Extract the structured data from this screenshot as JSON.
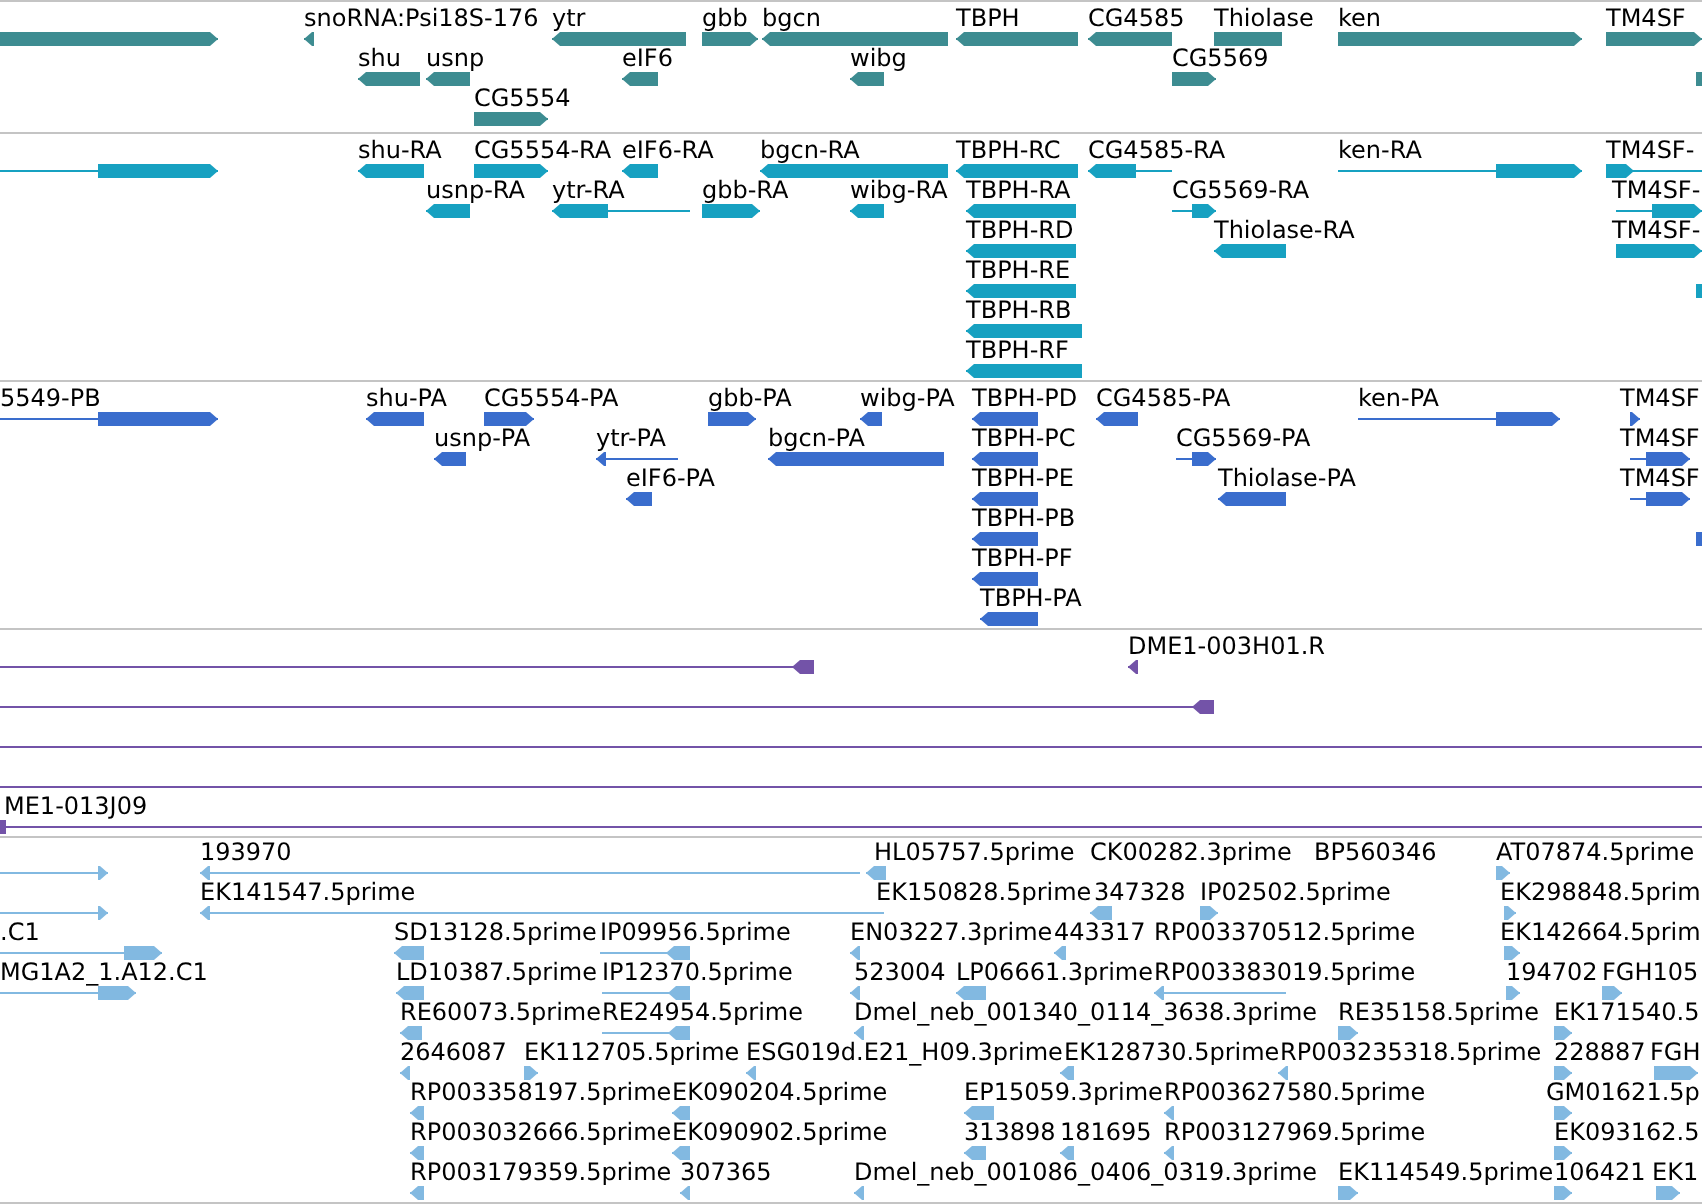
{
  "tracks": [
    {
      "kind": "genes",
      "rows": [
        {
          "features": [
            {
              "kind": "forward"
            },
            {
              "label": "snoRNA:Psi18S-176",
              "kind": "reverse"
            },
            {
              "label": "ytr",
              "kind": "reverse"
            },
            {
              "label": "gbb",
              "kind": "forward"
            },
            {
              "label": "bgcn",
              "kind": "reverse"
            },
            {
              "label": "TBPH",
              "kind": "reverse"
            },
            {
              "label": "CG4585",
              "kind": "reverse"
            },
            {
              "label": "Thiolase",
              "kind": "plain"
            },
            {
              "label": "ken",
              "kind": "forward"
            },
            {
              "label": "TM4SF",
              "kind": "forward"
            }
          ]
        },
        {
          "features": [
            {
              "label": "shu",
              "kind": "reverse"
            },
            {
              "label": "usnp",
              "kind": "reverse"
            },
            {
              "label": "eIF6",
              "kind": "reverse"
            },
            {
              "label": "wibg",
              "kind": "reverse"
            },
            {
              "label": "CG5569",
              "kind": "forward"
            },
            {
              "kind": "plain"
            }
          ]
        },
        {
          "features": [
            {
              "label": "CG5554",
              "kind": "forward"
            }
          ]
        }
      ]
    },
    {
      "kind": "transcripts",
      "rows": [
        {
          "features": [
            {
              "kind": "forward"
            },
            {
              "label": "shu-RA",
              "kind": "reverse"
            },
            {
              "label": "CG5554-RA",
              "kind": "forward"
            },
            {
              "label": "eIF6-RA",
              "kind": "reverse"
            },
            {
              "label": "bgcn-RA",
              "kind": "reverse"
            },
            {
              "label": "TBPH-RC",
              "kind": "reverse"
            },
            {
              "label": "CG4585-RA",
              "kind": "reverse"
            },
            {
              "label": "ken-RA",
              "kind": "forward"
            },
            {
              "label": "TM4SF-",
              "kind": "forward"
            }
          ]
        },
        {
          "features": [
            {
              "label": "usnp-RA",
              "kind": "reverse"
            },
            {
              "label": "ytr-RA",
              "kind": "reverse"
            },
            {
              "label": "gbb-RA",
              "kind": "forward"
            },
            {
              "label": "wibg-RA",
              "kind": "reverse"
            },
            {
              "label": "TBPH-RA",
              "kind": "reverse"
            },
            {
              "label": "CG5569-RA",
              "kind": "forward"
            },
            {
              "label": "TM4SF-",
              "kind": "forward"
            }
          ]
        },
        {
          "features": [
            {
              "label": "TBPH-RD",
              "kind": "reverse"
            },
            {
              "label": "Thiolase-RA",
              "kind": "reverse"
            },
            {
              "label": "TM4SF-",
              "kind": "forward"
            }
          ]
        },
        {
          "features": [
            {
              "label": "TBPH-RE",
              "kind": "reverse"
            },
            {
              "kind": "plain"
            }
          ]
        },
        {
          "features": [
            {
              "label": "TBPH-RB",
              "kind": "reverse"
            }
          ]
        },
        {
          "features": [
            {
              "label": "TBPH-RF",
              "kind": "reverse"
            }
          ]
        }
      ]
    },
    {
      "kind": "proteins",
      "rows": [
        {
          "features": [
            {
              "label": "5549-PB",
              "kind": "forward"
            },
            {
              "label": "shu-PA",
              "kind": "reverse"
            },
            {
              "label": "CG5554-PA",
              "kind": "forward"
            },
            {
              "label": "gbb-PA",
              "kind": "forward"
            },
            {
              "label": "wibg-PA",
              "kind": "reverse"
            },
            {
              "label": "TBPH-PD",
              "kind": "reverse"
            },
            {
              "label": "CG4585-PA",
              "kind": "reverse"
            },
            {
              "label": "ken-PA",
              "kind": "forward"
            },
            {
              "label": "TM4SF",
              "kind": "forward"
            }
          ]
        },
        {
          "features": [
            {
              "label": "usnp-PA",
              "kind": "reverse"
            },
            {
              "label": "ytr-PA",
              "kind": "reverse"
            },
            {
              "label": "bgcn-PA",
              "kind": "reverse"
            },
            {
              "label": "TBPH-PC",
              "kind": "reverse"
            },
            {
              "label": "CG5569-PA",
              "kind": "forward"
            },
            {
              "label": "TM4SF",
              "kind": "forward"
            }
          ]
        },
        {
          "features": [
            {
              "label": "eIF6-PA",
              "kind": "reverse"
            },
            {
              "label": "TBPH-PE",
              "kind": "reverse"
            },
            {
              "label": "Thiolase-PA",
              "kind": "reverse"
            },
            {
              "label": "TM4SF",
              "kind": "forward"
            }
          ]
        },
        {
          "features": [
            {
              "label": "TBPH-PB",
              "kind": "reverse"
            },
            {
              "kind": "plain"
            }
          ]
        },
        {
          "features": [
            {
              "label": "TBPH-PF",
              "kind": "reverse"
            }
          ]
        },
        {
          "features": [
            {
              "label": "TBPH-PA",
              "kind": "reverse"
            }
          ]
        }
      ]
    },
    {
      "kind": "clones",
      "rows": [
        {
          "features": [
            {
              "kind": "reverse"
            },
            {
              "label": "DME1-003H01.R",
              "kind": "reverse"
            }
          ]
        },
        {
          "features": [
            {
              "kind": "reverse"
            }
          ]
        },
        {
          "features": [
            {
              "kind": "plain"
            }
          ]
        },
        {
          "features": [
            {
              "kind": "plain"
            }
          ]
        },
        {
          "features": [
            {
              "label": "ME1-013J09",
              "kind": "plain"
            }
          ]
        }
      ]
    },
    {
      "kind": "ests",
      "rows": [
        {
          "features": [
            {
              "kind": "forward"
            },
            {
              "label": "193970",
              "kind": "reverse"
            },
            {
              "label": "HL05757.5prime",
              "kind": "reverse"
            },
            {
              "label": "CK00282.3prime",
              "kind": "text"
            },
            {
              "label": "BP560346",
              "kind": "text"
            },
            {
              "label": "AT07874.5prime",
              "kind": "forward"
            }
          ]
        },
        {
          "features": [
            {
              "kind": "forward"
            },
            {
              "label": "EK141547.5prime",
              "kind": "reverse"
            },
            {
              "label": "EK150828.5prime",
              "kind": "text"
            },
            {
              "label": "347328",
              "kind": "reverse"
            },
            {
              "label": "IP02502.5prime",
              "kind": "forward"
            },
            {
              "label": "EK298848.5prim",
              "kind": "forward"
            }
          ]
        },
        {
          "features": [
            {
              "label": ".C1",
              "kind": "forward"
            },
            {
              "label": "SD13128.5prime",
              "kind": "reverse"
            },
            {
              "label": "IP09956.5prime",
              "kind": "reverse"
            },
            {
              "label": "EN03227.3prime",
              "kind": "reverse"
            },
            {
              "label": "443317",
              "kind": "reverse"
            },
            {
              "label": "RP003370512.5prime",
              "kind": "text"
            },
            {
              "label": "EK142664.5prim",
              "kind": "forward"
            }
          ]
        },
        {
          "features": [
            {
              "label": "MG1A2_1.A12.C1",
              "kind": "forward"
            },
            {
              "label": "LD10387.5prime",
              "kind": "reverse"
            },
            {
              "label": "IP12370.5prime",
              "kind": "reverse"
            },
            {
              "label": "523004",
              "kind": "reverse"
            },
            {
              "label": "LP06661.3prime",
              "kind": "reverse"
            },
            {
              "label": "RP003383019.5prime",
              "kind": "reverse"
            },
            {
              "label": "194702",
              "kind": "forward"
            },
            {
              "label": "FGH105",
              "kind": "forward"
            }
          ]
        },
        {
          "features": [
            {
              "label": "RE60073.5prime",
              "kind": "reverse"
            },
            {
              "label": "RE24954.5prime",
              "kind": "reverse"
            },
            {
              "label": "Dmel_neb_001340_0114_3638.3prime",
              "kind": "reverse"
            },
            {
              "label": "RE35158.5prime",
              "kind": "forward"
            },
            {
              "label": "EK171540.5",
              "kind": "forward"
            }
          ]
        },
        {
          "features": [
            {
              "label": "2646087",
              "kind": "reverse"
            },
            {
              "label": "EK112705.5prime",
              "kind": "forward"
            },
            {
              "label": "ESG019d.E21_H09.3prime",
              "kind": "reverse"
            },
            {
              "label": "EK128730.5prime",
              "kind": "reverse"
            },
            {
              "label": "RP003235318.5prime",
              "kind": "reverse"
            },
            {
              "label": "228887",
              "kind": "forward"
            },
            {
              "label": "FGH",
              "kind": "forward"
            }
          ]
        },
        {
          "features": [
            {
              "label": "RP003358197.5prime",
              "kind": "reverse"
            },
            {
              "label": "EK090204.5prime",
              "kind": "reverse"
            },
            {
              "label": "EP15059.3prime",
              "kind": "reverse"
            },
            {
              "label": "RP003627580.5prime",
              "kind": "reverse"
            },
            {
              "label": "GM01621.5p",
              "kind": "forward"
            }
          ]
        },
        {
          "features": [
            {
              "label": "RP003032666.5prime",
              "kind": "reverse"
            },
            {
              "label": "EK090902.5prime",
              "kind": "reverse"
            },
            {
              "label": "313898",
              "kind": "reverse"
            },
            {
              "label": "181695",
              "kind": "reverse"
            },
            {
              "label": "RP003127969.5prime",
              "kind": "reverse"
            },
            {
              "label": "EK093162.5",
              "kind": "forward"
            }
          ]
        },
        {
          "features": [
            {
              "label": "RP003179359.5prime",
              "kind": "reverse"
            },
            {
              "label": "307365",
              "kind": "reverse"
            },
            {
              "label": "Dmel_neb_001086_0406_0319.3prime",
              "kind": "reverse"
            },
            {
              "label": "EK114549.5prime",
              "kind": "forward"
            },
            {
              "label": "106421",
              "kind": "forward"
            },
            {
              "label": "EK1",
              "kind": "forward"
            }
          ]
        }
      ]
    }
  ]
}
